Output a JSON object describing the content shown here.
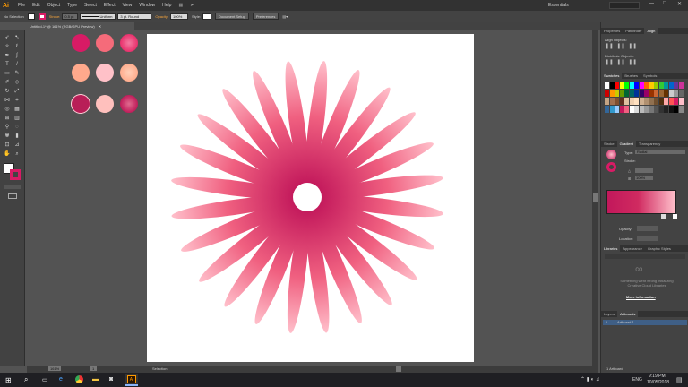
{
  "menubar": {
    "logo": "Ai",
    "items": [
      "File",
      "Edit",
      "Object",
      "Type",
      "Select",
      "Effect",
      "View",
      "Window",
      "Help"
    ],
    "workspace": "Essentials",
    "controls": [
      "—",
      "□",
      "✕"
    ]
  },
  "controlbar": {
    "selection": "No Selection",
    "stroke_label": "Stroke:",
    "stroke_value": "0.5 pt",
    "profile": "Uniform",
    "brush": "3 pt. Round",
    "opacity_label": "Opacity:",
    "opacity_value": "100%",
    "style_label": "Style:",
    "doc_setup": "Document Setup",
    "preferences": "Preferences"
  },
  "document": {
    "tab": "Untitled-1* @ 161% (RGB/GPU Preview)",
    "tab_close": "✕"
  },
  "swatches": [
    {
      "color": "#d81b65"
    },
    {
      "color": "#f56b7a"
    },
    {
      "color": "#e8306c",
      "center": "#f37aa0"
    },
    {
      "color": "#ffa98c"
    },
    {
      "color": "#ffc1c8"
    },
    {
      "color": "#ffad8e",
      "center": "#ffd0b8"
    },
    {
      "color": "#b81e57"
    },
    {
      "color": "#ffc0bd"
    },
    {
      "color": "#c01c5a",
      "center": "#e06a8e"
    }
  ],
  "flower": {
    "petals": 24,
    "inner_color": "#c2185b",
    "outer_color": "#ffc0cb",
    "mid_color": "#f06080"
  },
  "panels": {
    "top_tabs": [
      "Properties",
      "Pathfinder",
      "Align"
    ],
    "align_objects": "Align Objects:",
    "distribute_objects": "Distribute Objects:",
    "swatch_tabs": [
      "Swatches",
      "Brushes",
      "Symbols"
    ],
    "gradient_tabs": [
      "Stroke",
      "Gradient",
      "Transparency"
    ],
    "gradient_type_label": "Type:",
    "gradient_type_value": "Radial",
    "gradient_stroke_label": "Stroke:",
    "gradient_scale": "100%",
    "opacity_label": "Opacity:",
    "location_label": "Location:",
    "library_tabs": [
      "Libraries",
      "Appearance",
      "Graphic Styles"
    ],
    "library_error": "Something went wrong initializing Creative Cloud Libraries",
    "more_info": "More information",
    "layer_tabs": [
      "Layers",
      "Artboards"
    ],
    "artboard_num": "1",
    "artboard_name": "Artboard 1",
    "artboard_count": "1 Artboard"
  },
  "status": {
    "zoom": "161%",
    "page": "1",
    "tool": "Selection"
  },
  "taskbar": {
    "time": "9:19 PM",
    "date": "10/05/2018",
    "lang": "ENG"
  },
  "colors": {
    "accent": "#ff9a00",
    "gradient_start": "#c2185b",
    "gradient_end": "#ffc0cb"
  }
}
